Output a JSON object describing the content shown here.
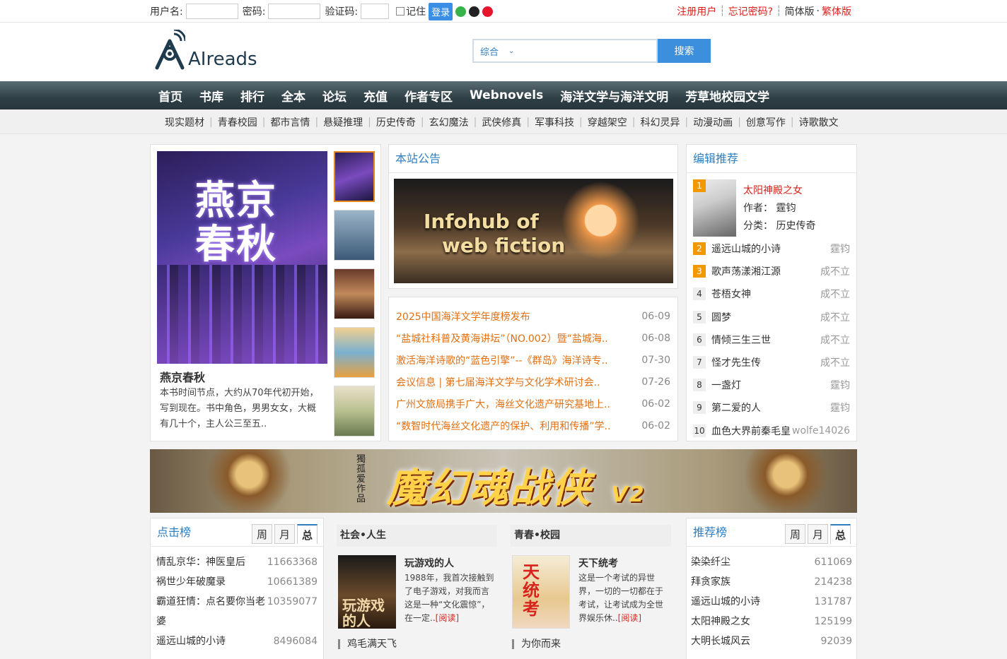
{
  "topbar": {
    "username_label": "用户名:",
    "password_label": "密码:",
    "captcha_label": "验证码:",
    "remember_label": "记住",
    "login_button": "登录",
    "register": "注册用户",
    "forgot": "忘记密码?",
    "simplified": "简体版",
    "dot": "·",
    "traditional": "繁体版"
  },
  "header": {
    "logo_text": "AIreads",
    "search_scope": "综合",
    "search_button": "搜索"
  },
  "mainnav": [
    "首页",
    "书库",
    "排行",
    "全本",
    "论坛",
    "充值",
    "作者专区",
    "Webnovels",
    "海洋文学与海洋文明",
    "芳草地校园文学"
  ],
  "subnav": [
    "现实题材",
    "青春校园",
    "都市言情",
    "悬疑推理",
    "历史传奇",
    "玄幻魔法",
    "武侠修真",
    "军事科技",
    "穿越架空",
    "科幻灵异",
    "动漫动画",
    "创意写作",
    "诗歌散文"
  ],
  "featured": {
    "cover_title": "燕京春秋",
    "name": "燕京春秋",
    "desc": "本书时间节点，大约从70年代初开始，写到现在。书中角色，男男女女，大概有几十个，主人公三至五.."
  },
  "announce": {
    "title": "本站公告",
    "banner_text_1": "Infohub of",
    "banner_text_2": "web fiction",
    "news": [
      {
        "t": "2025中国海洋文学年度榜发布",
        "d": "06-09"
      },
      {
        "t": "“盐城社科普及黄海讲坛”（NO.002）暨“盐城海..",
        "d": "06-08"
      },
      {
        "t": "激活海洋诗歌的“蓝色引擎”--《群岛》海洋诗专..",
        "d": "07-30"
      },
      {
        "t": "会议信息 | 第七届海洋文学与文化学术研讨会..",
        "d": "07-26"
      },
      {
        "t": "广州文旅局携手广大，海丝文化遗产研究基地上..",
        "d": "06-02"
      },
      {
        "t": "“数智时代海丝文化遗产的保护、利用和传播”学..",
        "d": "06-02"
      }
    ]
  },
  "editor": {
    "title": "编辑推荐",
    "top": {
      "num": "1",
      "name": "太阳神殿之女",
      "author": "作者：  霆钧",
      "category": "分类：  历史传奇"
    },
    "list": [
      {
        "no": "2",
        "name": "遥远山城的小诗",
        "author": "霆钧"
      },
      {
        "no": "3",
        "name": "歌声荡漾湘江源",
        "author": "成不立"
      },
      {
        "no": "4",
        "name": "苍梧女神",
        "author": "成不立"
      },
      {
        "no": "5",
        "name": "圆梦",
        "author": "成不立"
      },
      {
        "no": "6",
        "name": "情倾三生三世",
        "author": "成不立"
      },
      {
        "no": "7",
        "name": "怪才先生传",
        "author": "成不立"
      },
      {
        "no": "8",
        "name": "一盏灯",
        "author": "霆钧"
      },
      {
        "no": "9",
        "name": "第二爱的人",
        "author": "霆钧"
      },
      {
        "no": "10",
        "name": "血色大界前秦毛皇",
        "author": "wolfe14026"
      }
    ]
  },
  "bigbanner": {
    "title": "魔幻魂战侠",
    "version": "V2",
    "author": "獨孤爱作品"
  },
  "click_rank": {
    "title": "点击榜",
    "tabs": [
      "周",
      "月",
      "总"
    ],
    "items": [
      {
        "n": "情乱京华：神医皇后",
        "v": "11663368"
      },
      {
        "n": "祸世少年破魔录",
        "v": "10661389"
      },
      {
        "n": "霸道狂情：点名要你当老婆",
        "v": "10359077"
      },
      {
        "n": "遥远山城的小诗",
        "v": "8496084"
      }
    ]
  },
  "col_social": {
    "head": "社会•人生",
    "book": "玩游戏的人",
    "cover_text": "玩游戏的人",
    "desc": "1988年，我首次接触到了电子游戏，对我而言这是一种“文化震惊”，在一定..",
    "read": "[阅读]",
    "more": "鸡毛满天飞"
  },
  "col_youth": {
    "head": "青春•校园",
    "book": "天下统考",
    "cover_text": "天统考",
    "desc": "这是一个考试的异世界，一切的一切都在于考试，让考试成为全世界娱乐休..",
    "read": "[阅读]",
    "more": "为你而来"
  },
  "rec_rank": {
    "title": "推荐榜",
    "tabs": [
      "周",
      "月",
      "总"
    ],
    "items": [
      {
        "n": "染染纤尘",
        "v": "611069"
      },
      {
        "n": "拜贪家族",
        "v": "214238"
      },
      {
        "n": "遥远山城的小诗",
        "v": "131787"
      },
      {
        "n": "太阳神殿之女",
        "v": "125199"
      },
      {
        "n": "大明长城风云",
        "v": "92039"
      }
    ]
  }
}
